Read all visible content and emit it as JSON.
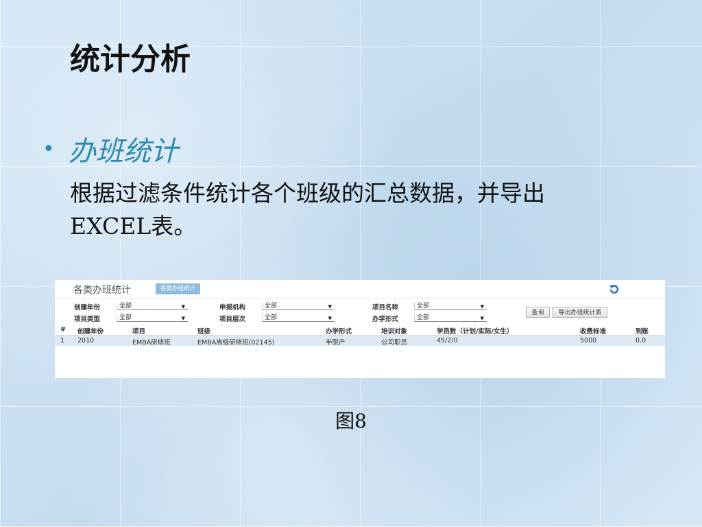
{
  "slide": {
    "title": "统计分析",
    "bullet_heading": "办班统计",
    "body_line1": "根据过滤条件统计各个班级的汇总数据，并导出",
    "body_line2": "EXCEL表。",
    "caption": "图8"
  },
  "panel": {
    "title": "各类办班统计",
    "tab": "各类办班统计",
    "filters": [
      {
        "label": "创建年份",
        "value": "全部"
      },
      {
        "label": "项目类型",
        "value": "全部"
      },
      {
        "label": "申报机构",
        "value": "全部"
      },
      {
        "label": "项目层次",
        "value": "全部"
      },
      {
        "label": "项目名称",
        "value": "全部"
      },
      {
        "label": "办学形式",
        "value": "全部"
      }
    ],
    "query_button": "查询",
    "export_button": "导出办班统计表",
    "columns": [
      "#",
      "创建年份",
      "项目",
      "班级",
      "办学形式",
      "培训对象",
      "学员数（计划/实际/女生）",
      "收费标准",
      "到账"
    ],
    "rows": [
      [
        "1",
        "2010",
        "EMBA研修班",
        "EMBA高级研修班(02145)",
        "半脱产",
        "公司职员",
        "45/2/0",
        "5000",
        "0.0"
      ]
    ]
  },
  "colors": {
    "accent": "#2b8ab0",
    "tab": "#8cbde0",
    "row": "#dde8f5"
  }
}
